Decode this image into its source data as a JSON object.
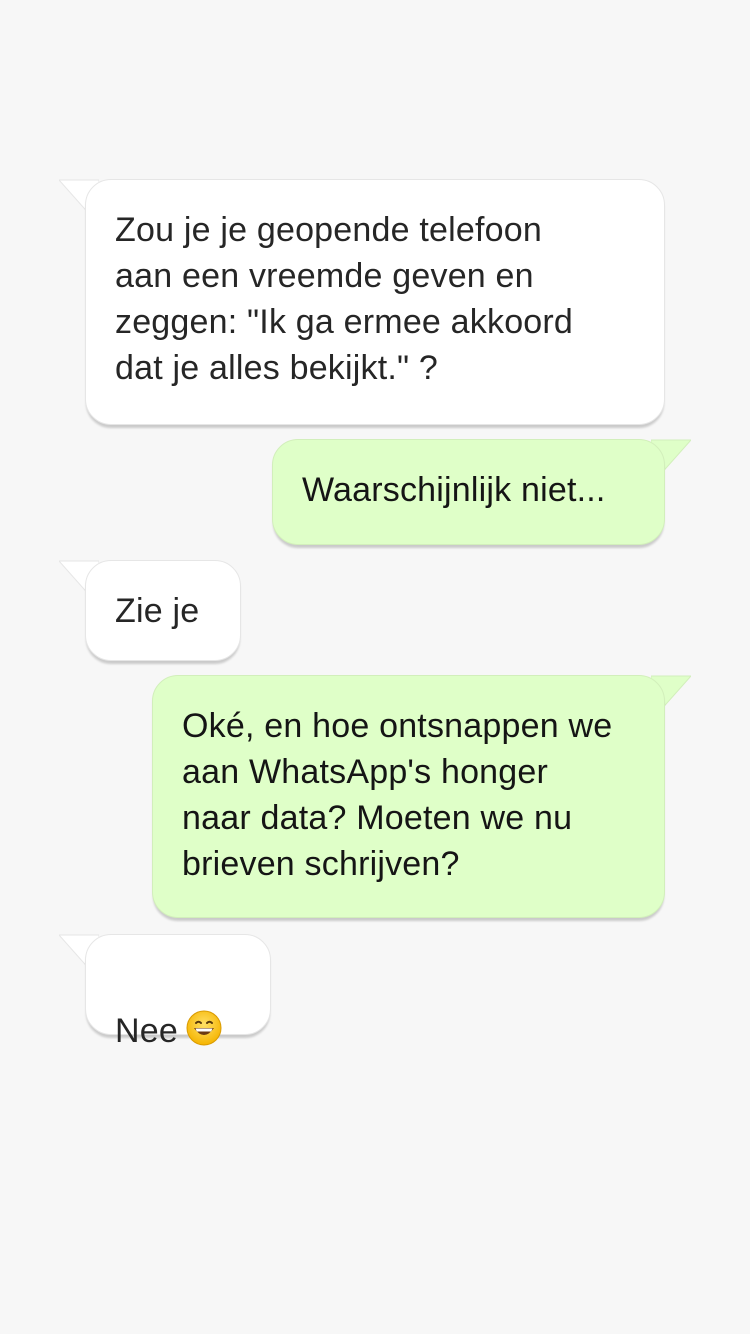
{
  "conversation": {
    "messages": [
      {
        "direction": "incoming",
        "text": "Zou je je geopende telefoon\naan een vreemde geven en\nzeggen: \"Ik ga ermee akkoord\ndat je alles bekijkt.\" ?"
      },
      {
        "direction": "outgoing",
        "text": "Waarschijnlijk niet..."
      },
      {
        "direction": "incoming",
        "text": "Zie je"
      },
      {
        "direction": "outgoing",
        "text": "Oké, en hoe ontsnappen we\naan WhatsApp's honger\nnaar data? Moeten we nu\nbrieven schrijven?"
      },
      {
        "direction": "incoming",
        "text": "Nee",
        "emoji": "grinning-face-icon"
      }
    ]
  },
  "colors": {
    "background": "#f7f7f7",
    "incoming_bubble": "#ffffff",
    "outgoing_bubble": "#dfffc8"
  }
}
